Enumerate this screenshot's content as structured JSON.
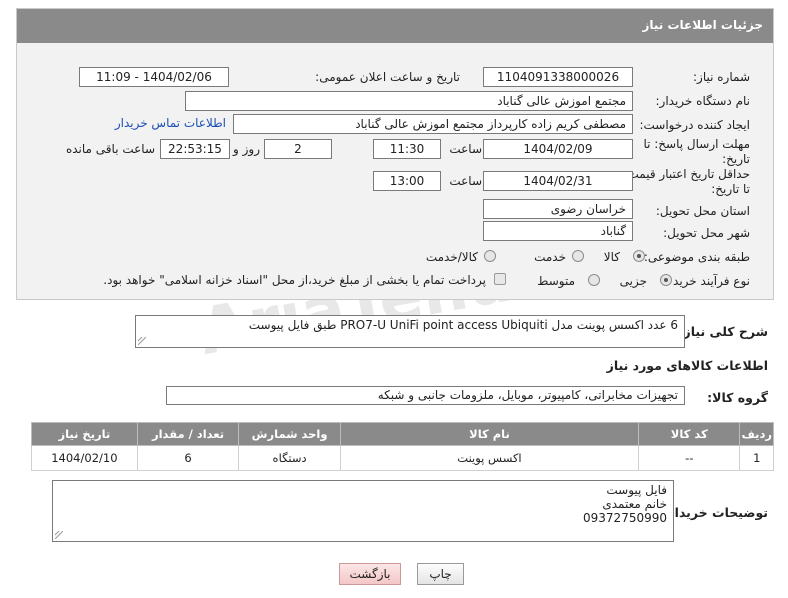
{
  "header": {
    "title": "جزئیات اطلاعات نیاز"
  },
  "form": {
    "need_number_label": "شماره نیاز:",
    "need_number": "1104091338000026",
    "announce_label": "تاریخ و ساعت اعلان عمومی:",
    "announce_value": "1404/02/06 - 11:09",
    "buyer_org_label": "نام دستگاه خریدار:",
    "buyer_org": "مجتمع اموزش عالی گناباد",
    "requester_label": "ایجاد کننده درخواست:",
    "requester": "مصطفی کریم زاده کارپرداز مجتمع اموزش عالی گناباد",
    "buyer_contact_link": "اطلاعات تماس خریدار",
    "deadline_label_1": "مهلت ارسال پاسخ: تا",
    "deadline_label_2": "تاریخ:",
    "deadline_date": "1404/02/09",
    "time_label": "ساعت",
    "deadline_time": "11:30",
    "days_value": "2",
    "days_label": "روز و",
    "remaining_time": "22:53:15",
    "remaining_label": "ساعت باقی مانده",
    "validity_label_1": "حداقل تاریخ اعتبار قیمت:",
    "validity_label_2": "تا تاریخ:",
    "validity_date": "1404/02/31",
    "validity_time": "13:00",
    "province_label": "استان محل تحویل:",
    "province": "خراسان رضوی",
    "city_label": "شهر محل تحویل:",
    "city": "گناباد",
    "category_label": "طبقه بندی موضوعی:",
    "category_options": [
      "کالا",
      "خدمت",
      "کالا/خدمت"
    ],
    "process_label": "نوع فرآیند خرید :",
    "process_options": [
      "جزیی",
      "متوسط"
    ],
    "treasury_note": "پرداخت تمام یا بخشی از مبلغ خرید،از محل \"اسناد خزانه اسلامی\" خواهد بود."
  },
  "description": {
    "label": "شرح کلی نیاز:",
    "value": "6 عدد اکسس پوینت مدل  PRO7-U UniFi point access Ubiquiti  طبق فایل پیوست"
  },
  "goods": {
    "section_title": "اطلاعات کالاهای مورد نیاز",
    "group_label": "گروه کالا:",
    "group_value": "تجهیزات مخابراتی، کامپیوتر، موبایل، ملزومات جانبی و شبکه",
    "columns": [
      "ردیف",
      "کد کالا",
      "نام کالا",
      "واحد شمارش",
      "تعداد / مقدار",
      "تاریخ نیاز"
    ],
    "rows": [
      [
        "1",
        "--",
        "اکسس پوینت",
        "دستگاه",
        "6",
        "1404/02/10"
      ]
    ]
  },
  "buyer_notes": {
    "label": "توضیحات خریدار:",
    "line1": "فایل پیوست",
    "line2": "خانم معتمدی",
    "line3": "09372750990"
  },
  "buttons": {
    "print": "چاپ",
    "back": "بازگشت"
  },
  "watermark": "AriaTender.neT",
  "colors": {
    "header_bg": "#8a8a8a",
    "panel_bg": "#f2f2f2",
    "link": "#1a4fb5",
    "back_button": "#f3c7c7"
  }
}
